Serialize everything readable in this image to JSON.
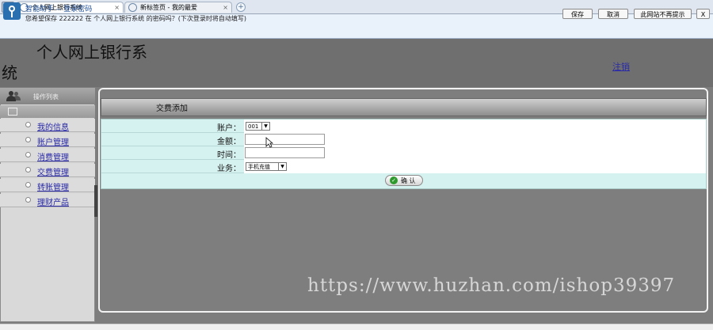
{
  "browser": {
    "tabs": [
      {
        "label": "个人网上银行系统",
        "close": "×"
      },
      {
        "label": "新标签页 - 我的最爱",
        "close": "×"
      }
    ],
    "new_tab": "+"
  },
  "password_helper": {
    "title": "智能助手 -- 登录密码",
    "message": "您希望保存 222222 在 个人网上银行系统 的密码吗？(下次登录时将自动填写)",
    "buttons": {
      "save": "保存",
      "cancel": "取消",
      "never": "此网站不再提示",
      "close": "X"
    }
  },
  "header": {
    "title_line1": "个人网上银行系",
    "title_line2": "统",
    "logout": "注销"
  },
  "sidebar": {
    "title": "操作列表",
    "items": [
      {
        "label": "我的信息"
      },
      {
        "label": "账户管理"
      },
      {
        "label": "消费管理"
      },
      {
        "label": "交费管理"
      },
      {
        "label": "转账管理"
      },
      {
        "label": "理财产品"
      }
    ]
  },
  "panel": {
    "title": "交费添加",
    "form": {
      "account_label": "账户：",
      "account_value": "001",
      "amount_label": "金额：",
      "amount_value": "",
      "time_label": "时间：",
      "time_value": "",
      "business_label": "业务：",
      "business_value": "手机充值",
      "confirm_label": "确 认"
    }
  },
  "watermark": "https://www.huzhan.com/ishop39397"
}
